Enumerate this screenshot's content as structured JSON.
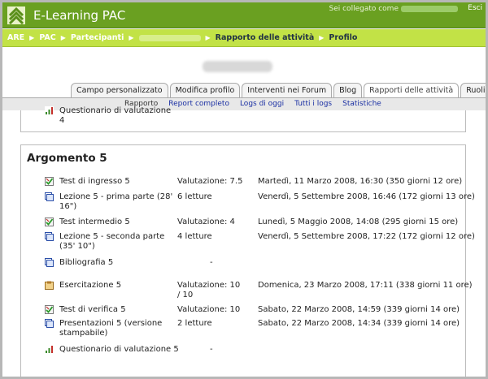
{
  "header": {
    "site_title": "E-Learning PAC",
    "login_text": "Sei collegato come",
    "logout_label": "Esci"
  },
  "breadcrumb": {
    "items": [
      "ARE",
      "PAC",
      "Partecipanti"
    ],
    "current": [
      "Rapporto delle attività",
      "Profilo"
    ]
  },
  "tabs": [
    {
      "label": "Campo personalizzato"
    },
    {
      "label": "Modifica profilo"
    },
    {
      "label": "Interventi nei Forum"
    },
    {
      "label": "Blog"
    },
    {
      "label": "Rapporti delle attività",
      "active": true
    },
    {
      "label": "Ruoli"
    }
  ],
  "subtabs": [
    {
      "label": "Rapporto",
      "current": true
    },
    {
      "label": "Report completo"
    },
    {
      "label": "Logs di oggi"
    },
    {
      "label": "Tutti i logs"
    },
    {
      "label": "Statistiche"
    }
  ],
  "prev_section": {
    "partial_line1": "Questionario di valutazione",
    "partial_line2": "4"
  },
  "section": {
    "title": "Argomento 5",
    "rows": [
      {
        "icon": "quiz-icon",
        "activity": "Test di ingresso 5",
        "grade": "Valutazione: 7.5",
        "date": "Martedì, 11 Marzo 2008, 16:30 (350 giorni 12 ore)"
      },
      {
        "icon": "resource-icon",
        "activity": "Lezione 5 - prima parte (28' 16\")",
        "grade": "6 letture",
        "date": "Venerdì, 5 Settembre 2008, 16:46 (172 giorni 13 ore)"
      },
      {
        "icon": "quiz-icon",
        "activity": "Test intermedio 5",
        "grade": "Valutazione: 4",
        "date": "Lunedì, 5 Maggio 2008, 14:08 (295 giorni 15 ore)"
      },
      {
        "icon": "resource-icon",
        "activity": "Lezione 5 - seconda parte (35' 10\")",
        "grade": "4 letture",
        "date": "Venerdì, 5 Settembre 2008, 17:22 (172 giorni 12 ore)"
      },
      {
        "icon": "resource-icon",
        "activity": "Bibliografia 5",
        "grade": "-",
        "date": ""
      },
      {
        "icon": "assignment-icon",
        "activity": "Esercitazione 5",
        "grade": "Valutazione: 10 / 10",
        "date": "Domenica, 23 Marzo 2008, 17:11 (338 giorni 11 ore)"
      },
      {
        "icon": "quiz-icon",
        "activity": "Test di verifica 5",
        "grade": "Valutazione: 10",
        "date": "Sabato, 22 Marzo 2008, 14:59 (339 giorni 14 ore)"
      },
      {
        "icon": "resource-icon",
        "activity": "Presentazioni 5 (versione stampabile)",
        "grade": "2 letture",
        "date": "Sabato, 22 Marzo 2008, 14:34 (339 giorni 14 ore)"
      },
      {
        "icon": "feedback-icon",
        "activity": "Questionario di valutazione 5",
        "grade": "-",
        "date": ""
      }
    ]
  },
  "colors": {
    "header": "#6aa021",
    "navbar": "#c2e246",
    "link": "#1a2fa3"
  }
}
